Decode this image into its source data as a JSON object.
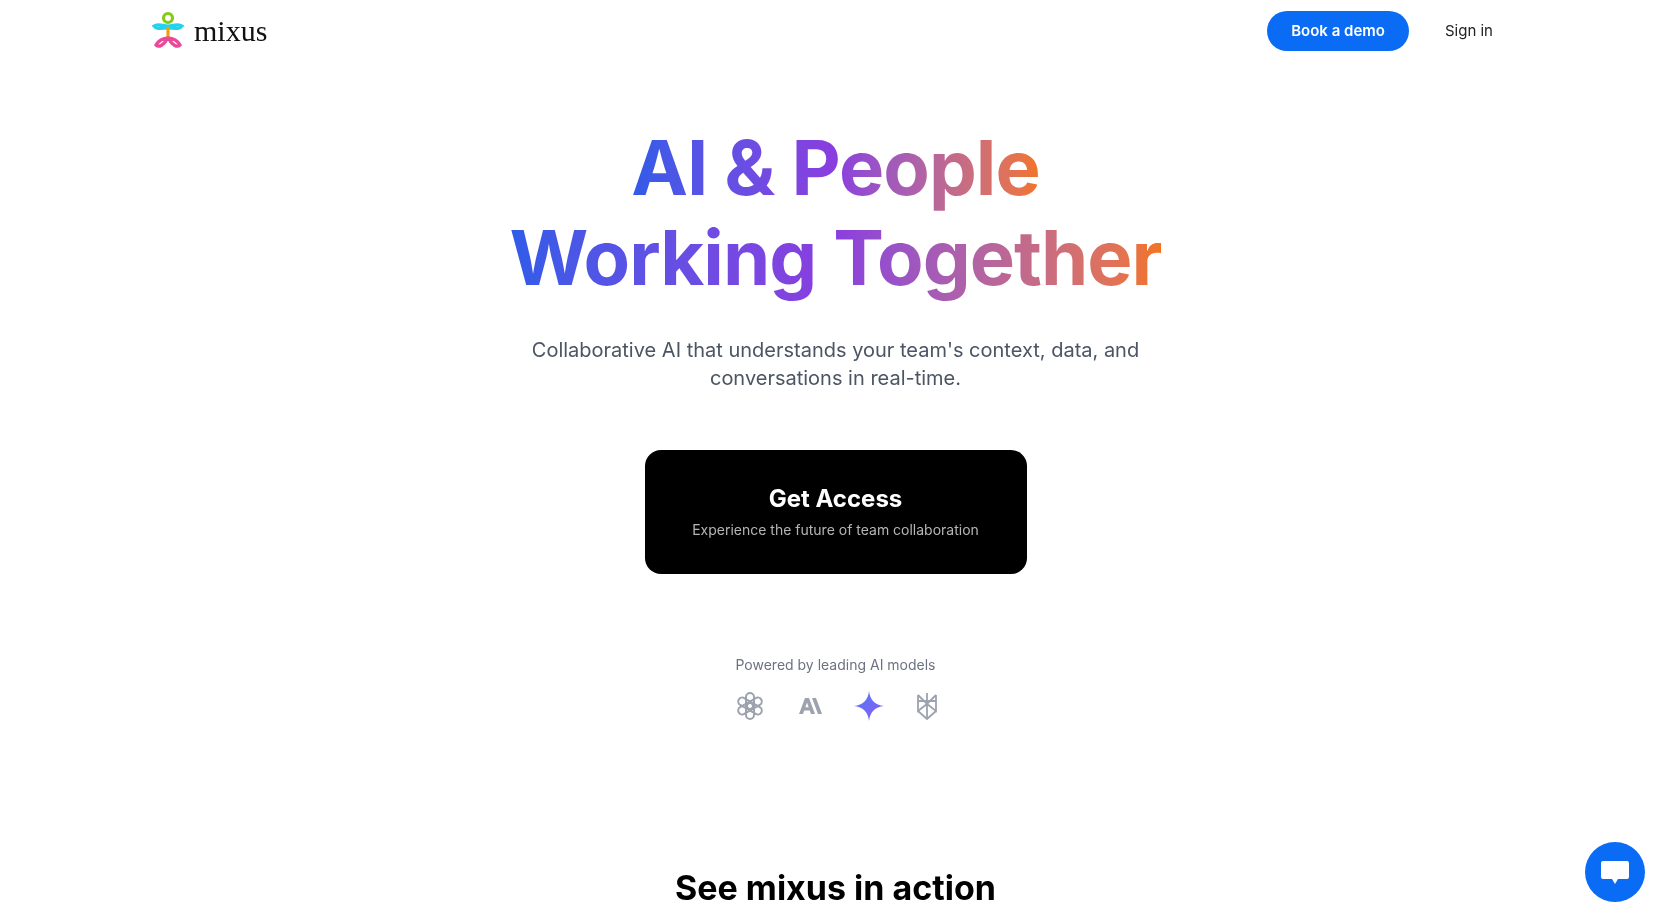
{
  "header": {
    "logo": "mixus",
    "book_demo": "Book a demo",
    "sign_in": "Sign in"
  },
  "hero": {
    "title_lines": [
      "AI & People",
      "Working Together"
    ],
    "subtitle": "Collaborative AI that understands your team's context, data, and conversations in real-time.",
    "cta": {
      "title": "Get Access",
      "subtitle": "Experience the future of team collaboration"
    },
    "powered_by": "Powered by leading AI models"
  },
  "next_section": {
    "heading": "See mixus in action"
  }
}
